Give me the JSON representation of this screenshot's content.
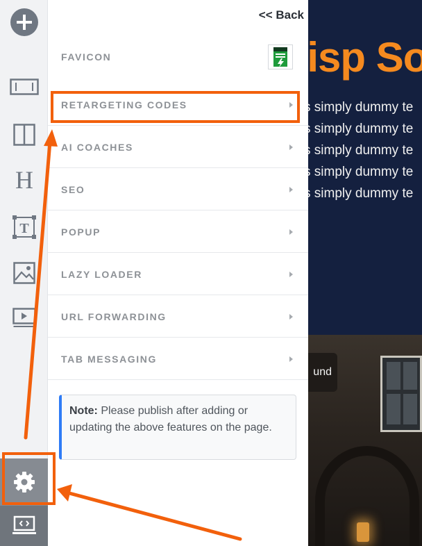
{
  "panel": {
    "back_label": "<< Back",
    "items": [
      {
        "label": "FAVICON",
        "has_arrow": false
      },
      {
        "label": "RETARGETING CODES",
        "has_arrow": true
      },
      {
        "label": "AI COACHES",
        "has_arrow": true
      },
      {
        "label": "SEO",
        "has_arrow": true
      },
      {
        "label": "POPUP",
        "has_arrow": true
      },
      {
        "label": "LAZY LOADER",
        "has_arrow": true
      },
      {
        "label": "URL FORWARDING",
        "has_arrow": true
      },
      {
        "label": "TAB MESSAGING",
        "has_arrow": true
      }
    ],
    "note": {
      "title": "Note:",
      "text": "Please publish after adding or updating the above features on the page."
    }
  },
  "rail": {
    "icons": [
      "add-icon",
      "section-icon",
      "columns-icon",
      "heading-icon",
      "text-icon",
      "image-icon",
      "video-icon",
      "settings-icon",
      "preview-icon"
    ]
  },
  "preview": {
    "hero_title": "risp So",
    "hero_lines": [
      "s simply dummy te",
      "s simply dummy te",
      "s simply dummy te",
      "s simply dummy te",
      "s simply dummy te"
    ],
    "button_text": "und"
  },
  "annotations": {
    "highlight_color": "#f2600c"
  }
}
